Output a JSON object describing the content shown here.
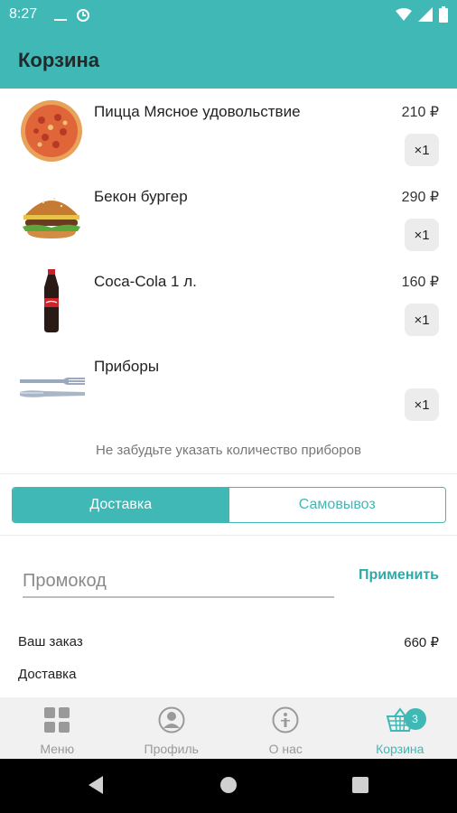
{
  "status_bar": {
    "time": "8:27",
    "icons": [
      "minus-icon",
      "data-saver-icon",
      "wifi-icon",
      "cell-signal-icon",
      "battery-icon"
    ]
  },
  "app_bar": {
    "title": "Корзина"
  },
  "cart": {
    "items": [
      {
        "name": "Пицца Мясное удовольствие",
        "price": "210 ₽",
        "qty": "×1",
        "image": "pizza-image"
      },
      {
        "name": "Бекон бургер",
        "price": "290 ₽",
        "qty": "×1",
        "image": "burger-image"
      },
      {
        "name": "Coca-Cola 1 л.",
        "price": "160 ₽",
        "qty": "×1",
        "image": "cola-bottle-image"
      },
      {
        "name": "Приборы",
        "price": "",
        "qty": "×1",
        "image": "cutlery-image"
      }
    ],
    "hint": "Не забудьте указать количество приборов"
  },
  "delivery_toggle": {
    "options": [
      "Доставка",
      "Самовывоз"
    ],
    "selected": "Доставка"
  },
  "promo": {
    "placeholder": "Промокод",
    "value": "",
    "apply_label": "Применить"
  },
  "summary": {
    "order_label": "Ваш заказ",
    "order_value": "660 ₽",
    "delivery_label": "Доставка"
  },
  "bottom_nav": {
    "items": [
      {
        "label": "Меню",
        "icon": "grid-icon"
      },
      {
        "label": "Профиль",
        "icon": "profile-icon"
      },
      {
        "label": "О нас",
        "icon": "info-icon"
      },
      {
        "label": "Корзина",
        "icon": "basket-icon",
        "badge": "3"
      }
    ],
    "active": "Корзина"
  },
  "colors": {
    "accent": "#3fb8b6",
    "nav_bg": "#f1f1f1",
    "qty_bg": "#ececec"
  }
}
